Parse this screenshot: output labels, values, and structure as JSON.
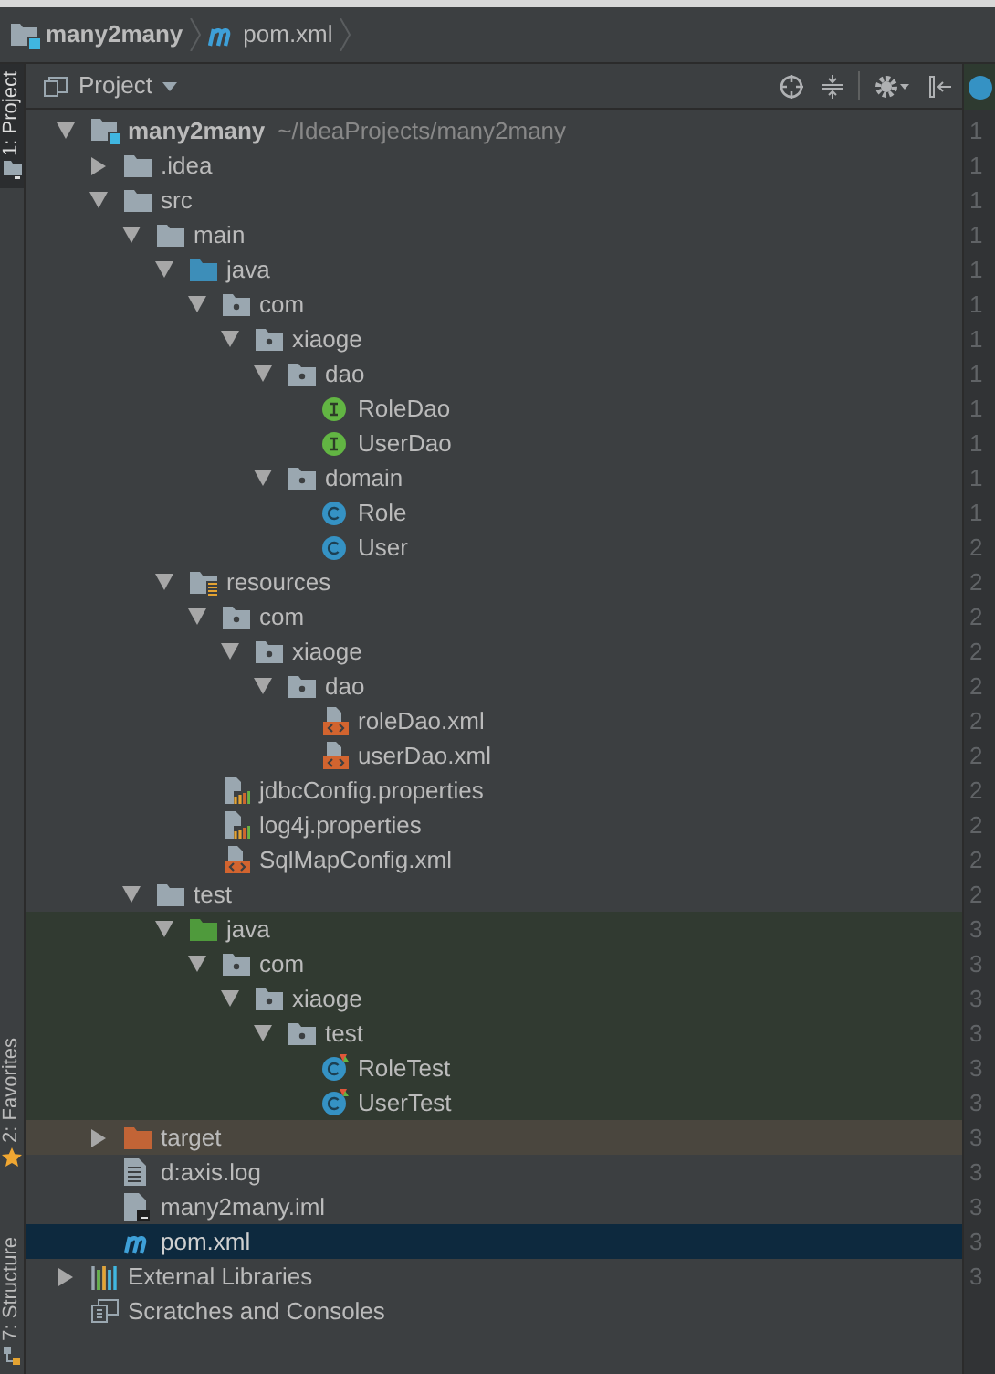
{
  "breadcrumb": [
    {
      "kind": "module",
      "label": "many2many"
    },
    {
      "kind": "maven",
      "label": "pom.xml"
    }
  ],
  "tool_strip": [
    {
      "label": "1: Project",
      "selected": true,
      "kind": "project"
    },
    {
      "label": "2: Favorites",
      "selected": false,
      "kind": "favorites"
    },
    {
      "label": "7: Structure",
      "selected": false,
      "kind": "structure"
    }
  ],
  "panel": {
    "title": "Project"
  },
  "tree": [
    {
      "label": "many2many",
      "path": "~/IdeaProjects/many2many",
      "kind": "module",
      "expanded": true,
      "selected": false,
      "children": [
        {
          "label": ".idea",
          "kind": "folder",
          "expanded": false,
          "selected": false
        },
        {
          "label": "src",
          "kind": "folder",
          "expanded": true,
          "selected": false,
          "children": [
            {
              "label": "main",
              "kind": "folder",
              "expanded": true,
              "selected": false,
              "children": [
                {
                  "label": "java",
                  "kind": "source",
                  "expanded": true,
                  "selected": false,
                  "children": [
                    {
                      "label": "com",
                      "kind": "package",
                      "expanded": true,
                      "selected": false,
                      "children": [
                        {
                          "label": "xiaoge",
                          "kind": "package",
                          "expanded": true,
                          "selected": false,
                          "children": [
                            {
                              "label": "dao",
                              "kind": "package",
                              "expanded": true,
                              "selected": false,
                              "children": [
                                {
                                  "label": "RoleDao",
                                  "kind": "interface",
                                  "selected": false
                                },
                                {
                                  "label": "UserDao",
                                  "kind": "interface",
                                  "selected": false
                                }
                              ]
                            },
                            {
                              "label": "domain",
                              "kind": "package",
                              "expanded": true,
                              "selected": false,
                              "children": [
                                {
                                  "label": "Role",
                                  "kind": "class",
                                  "selected": false
                                },
                                {
                                  "label": "User",
                                  "kind": "class",
                                  "selected": false
                                }
                              ]
                            }
                          ]
                        }
                      ]
                    }
                  ]
                },
                {
                  "label": "resources",
                  "kind": "resources",
                  "expanded": true,
                  "selected": false,
                  "children": [
                    {
                      "label": "com",
                      "kind": "package",
                      "expanded": true,
                      "selected": false,
                      "children": [
                        {
                          "label": "xiaoge",
                          "kind": "package",
                          "expanded": true,
                          "selected": false,
                          "children": [
                            {
                              "label": "dao",
                              "kind": "package",
                              "expanded": true,
                              "selected": false,
                              "children": [
                                {
                                  "label": "roleDao.xml",
                                  "kind": "xml",
                                  "selected": false
                                },
                                {
                                  "label": "userDao.xml",
                                  "kind": "xml",
                                  "selected": false
                                }
                              ]
                            }
                          ]
                        }
                      ]
                    },
                    {
                      "label": "jdbcConfig.properties",
                      "kind": "properties",
                      "selected": false
                    },
                    {
                      "label": "log4j.properties",
                      "kind": "properties",
                      "selected": false
                    },
                    {
                      "label": "SqlMapConfig.xml",
                      "kind": "xml",
                      "selected": false
                    }
                  ]
                }
              ]
            },
            {
              "label": "test",
              "kind": "folder",
              "expanded": true,
              "selected": false,
              "children": [
                {
                  "label": "java",
                  "kind": "test_source",
                  "test_root": true,
                  "expanded": true,
                  "selected": false,
                  "children": [
                    {
                      "label": "com",
                      "kind": "package",
                      "expanded": true,
                      "selected": false,
                      "children": [
                        {
                          "label": "xiaoge",
                          "kind": "package",
                          "expanded": true,
                          "selected": false,
                          "children": [
                            {
                              "label": "test",
                              "kind": "package",
                              "expanded": true,
                              "selected": false,
                              "children": [
                                {
                                  "label": "RoleTest",
                                  "kind": "test_class",
                                  "selected": false
                                },
                                {
                                  "label": "UserTest",
                                  "kind": "test_class",
                                  "selected": false
                                }
                              ]
                            }
                          ]
                        }
                      ]
                    }
                  ]
                }
              ]
            }
          ]
        },
        {
          "label": "target",
          "kind": "excluded",
          "excluded": true,
          "expanded": false,
          "selected": false
        },
        {
          "label": "d:axis.log",
          "kind": "text_file",
          "selected": false
        },
        {
          "label": "many2many.iml",
          "kind": "iml",
          "selected": false
        },
        {
          "label": "pom.xml",
          "kind": "maven",
          "selected": true
        }
      ]
    },
    {
      "label": "External Libraries",
      "kind": "libraries",
      "expanded": false,
      "selected": false
    },
    {
      "label": "Scratches and Consoles",
      "kind": "scratches",
      "selected": false
    }
  ],
  "gutter": [
    "1",
    "1",
    "1",
    "1",
    "1",
    "1",
    "1",
    "1",
    "1",
    "1",
    "1",
    "1",
    "2",
    "2",
    "2",
    "2",
    "2",
    "2",
    "2",
    "2",
    "2",
    "2",
    "2",
    "3",
    "3",
    "3",
    "3",
    "3",
    "3",
    "3",
    "3",
    "3",
    "3",
    "3"
  ]
}
